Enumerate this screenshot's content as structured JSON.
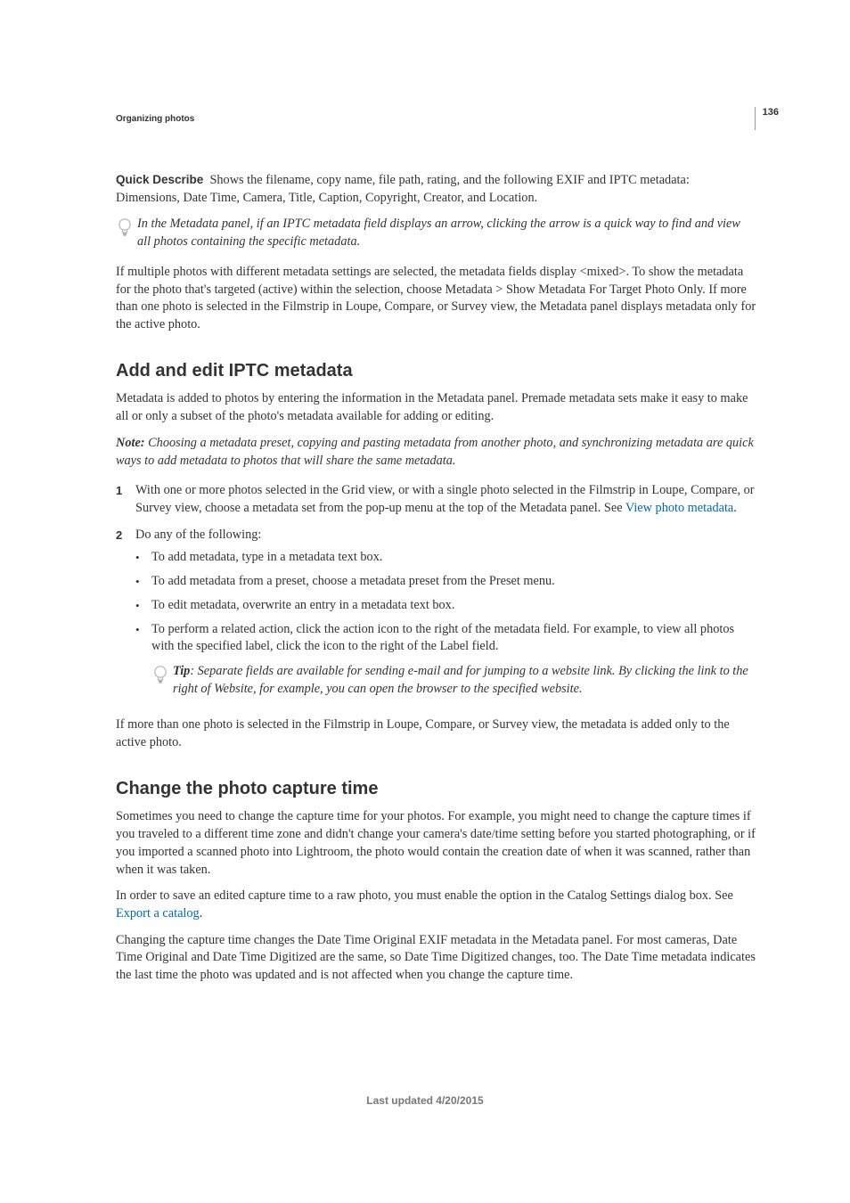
{
  "header": {
    "chapter": "Organizing photos",
    "page_number": "136"
  },
  "intro": {
    "quickDescribe": {
      "term": "Quick Describe",
      "text": "Shows the filename, copy name, file path, rating, and the following EXIF and IPTC metadata: Dimensions, Date Time, Camera, Title, Caption, Copyright, Creator, and Location."
    },
    "tip1": "In the Metadata panel, if an IPTC metadata field displays an arrow, clicking the arrow is a quick way to find and view all photos containing the specific metadata.",
    "mixed": "If multiple photos with different metadata settings are selected, the metadata fields display <mixed>. To show the metadata for the photo that's targeted (active) within the selection, choose Metadata > Show Metadata For Target Photo Only. If more than one photo is selected in the Filmstrip in Loupe, Compare, or Survey view, the Metadata panel displays metadata only for the active photo."
  },
  "sectionA": {
    "heading": "Add and edit IPTC metadata",
    "intro": "Metadata is added to photos by entering the information in the Metadata panel. Premade metadata sets make it easy to make all or only a subset of the photo's metadata available for adding or editing.",
    "note_label": "Note:",
    "note": " Choosing a metadata preset, copying and pasting metadata from another photo, and synchronizing metadata are quick ways to add metadata to photos that will share the same metadata.",
    "steps": [
      {
        "num": "1",
        "pre": "With one or more photos selected in the Grid view, or with a single photo selected in the Filmstrip in Loupe, Compare, or Survey view, choose a metadata set from the pop-up menu at the top of the Metadata panel. See ",
        "link": "View photo metadata",
        "post": "."
      },
      {
        "num": "2",
        "pre": "Do any of the following:",
        "bullets": [
          "To add metadata, type in a metadata text box.",
          "To add metadata from a preset, choose a metadata preset from the Preset menu.",
          "To edit metadata, overwrite an entry in a metadata text box.",
          "To perform a related action, click the action icon to the right of the metadata field. For example, to view all photos with the specified label, click the icon to the right of the Label field."
        ],
        "tip_label": "Tip",
        "tip": ": Separate fields are available for sending e-mail and for jumping to a website link. By clicking the link to the right of Website, for example, you can open the browser to the specified website."
      }
    ],
    "outro": "If more than one photo is selected in the Filmstrip in Loupe, Compare, or Survey view, the metadata is added only to the active photo."
  },
  "sectionB": {
    "heading": "Change the photo capture time",
    "paras": [
      "Sometimes you need to change the capture time for your photos. For example, you might need to change the capture times if you traveled to a different time zone and didn't change your camera's date/time setting before you started photographing, or if you imported a scanned photo into Lightroom, the photo would contain the creation date of when it was scanned, rather than when it was taken."
    ],
    "linkpara_pre": "In order to save an edited capture time to a raw photo, you must enable the option in the Catalog Settings dialog box. See ",
    "linkpara_link": "Export a catalog",
    "linkpara_post": ".",
    "para3": "Changing the capture time changes the Date Time Original EXIF metadata in the Metadata panel. For most cameras, Date Time Original and Date Time Digitized are the same, so Date Time Digitized changes, too. The Date Time metadata indicates the last time the photo was updated and is not affected when you change the capture time."
  },
  "footer": "Last updated 4/20/2015"
}
